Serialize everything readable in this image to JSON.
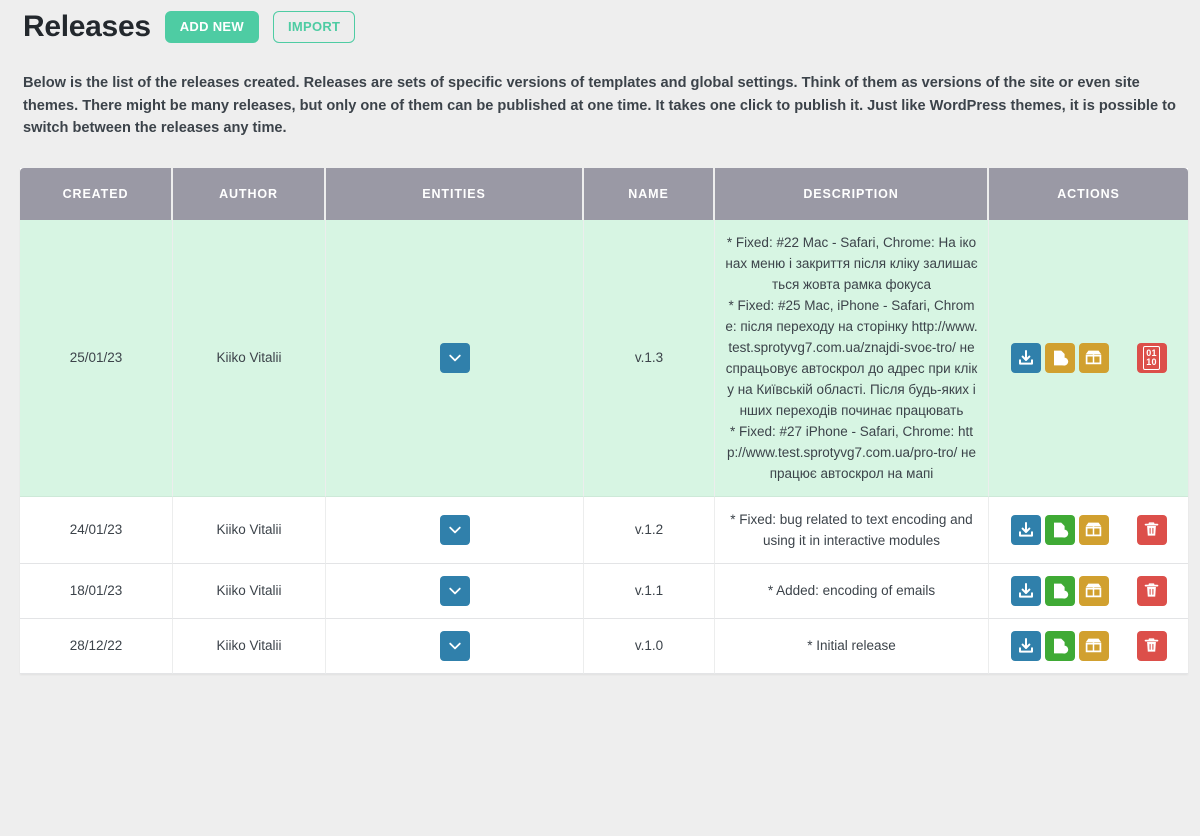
{
  "header": {
    "title": "Releases",
    "add_new_label": "ADD NEW",
    "import_label": "IMPORT"
  },
  "intro": "Below is the list of the releases created. Releases are sets of specific versions of templates and global settings. Think of them as versions of the site or even site themes. There might be many releases, but only one of them can be published at one time. It takes one click to publish it. Just like WordPress themes, it is possible to switch between the releases any time.",
  "table": {
    "columns": [
      {
        "key": "created",
        "label": "CREATED"
      },
      {
        "key": "author",
        "label": "AUTHOR"
      },
      {
        "key": "entities",
        "label": "ENTITIES"
      },
      {
        "key": "name",
        "label": "NAME"
      },
      {
        "key": "description",
        "label": "DESCRIPTION"
      },
      {
        "key": "actions",
        "label": "ACTIONS"
      }
    ],
    "rows": [
      {
        "created": "25/01/23",
        "author": "Kiiko Vitalii",
        "name": "v.1.3",
        "description": "* Fixed: #22 Mac - Safari, Chrome: На іконах меню і закриття після кліку залишається жовта рамка фокуса\n* Fixed: #25 Mac, iPhone - Safari, Chrome: після переходу на сторінку http://www.test.sprotyvg7.com.ua/znajdi-svoє-tro/ не спрацьовує автоскрол до адрес при кліку на Київській області. Після будь-яких інших переходів починає працювать\n* Fixed: #27 iPhone - Safari, Chrome: http://www.test.sprotyvg7.com.ua/pro-tro/ не працює автоскрол на мапі",
        "active": true,
        "actions": [
          {
            "name": "download-release-button",
            "icon": "download-icon",
            "color": "#3080ab"
          },
          {
            "name": "edit-release-button",
            "icon": "document-settings-icon",
            "color": "#d1a02f"
          },
          {
            "name": "publish-release-button",
            "icon": "open-box-icon",
            "color": "#d1a02f"
          },
          {
            "name": "source-code-button",
            "icon": "binary-code-icon",
            "color": "#dc4f4a"
          }
        ]
      },
      {
        "created": "24/01/23",
        "author": "Kiiko Vitalii",
        "name": "v.1.2",
        "description": "* Fixed: bug related to text encoding and using it in interactive modules",
        "active": false,
        "actions": [
          {
            "name": "download-release-button",
            "icon": "download-icon",
            "color": "#3080ab"
          },
          {
            "name": "edit-release-button",
            "icon": "document-settings-icon",
            "color": "#3faa35"
          },
          {
            "name": "publish-release-button",
            "icon": "open-box-icon",
            "color": "#d1a02f"
          },
          {
            "name": "delete-release-button",
            "icon": "trash-icon",
            "color": "#dc4f4a"
          }
        ]
      },
      {
        "created": "18/01/23",
        "author": "Kiiko Vitalii",
        "name": "v.1.1",
        "description": "* Added: encoding of emails",
        "active": false,
        "actions": [
          {
            "name": "download-release-button",
            "icon": "download-icon",
            "color": "#3080ab"
          },
          {
            "name": "edit-release-button",
            "icon": "document-settings-icon",
            "color": "#3faa35"
          },
          {
            "name": "publish-release-button",
            "icon": "open-box-icon",
            "color": "#d1a02f"
          },
          {
            "name": "delete-release-button",
            "icon": "trash-icon",
            "color": "#dc4f4a"
          }
        ]
      },
      {
        "created": "28/12/22",
        "author": "Kiiko Vitalii",
        "name": "v.1.0",
        "description": "* Initial release",
        "active": false,
        "actions": [
          {
            "name": "download-release-button",
            "icon": "download-icon",
            "color": "#3080ab"
          },
          {
            "name": "edit-release-button",
            "icon": "document-settings-icon",
            "color": "#3faa35"
          },
          {
            "name": "publish-release-button",
            "icon": "open-box-icon",
            "color": "#d1a02f"
          },
          {
            "name": "delete-release-button",
            "icon": "trash-icon",
            "color": "#dc4f4a"
          }
        ]
      }
    ],
    "entities_toggle_icon": "chevron-down-icon",
    "binary_icon_top": "01",
    "binary_icon_bottom": "10"
  },
  "colors": {
    "accent": "#4ecca3",
    "header_bg": "#9a99a5",
    "active_row": "#d7f5e3",
    "blue": "#3080ab",
    "green": "#3faa35",
    "ochre": "#d1a02f",
    "red": "#dc4f4a",
    "page_bg": "#eeeeee"
  }
}
